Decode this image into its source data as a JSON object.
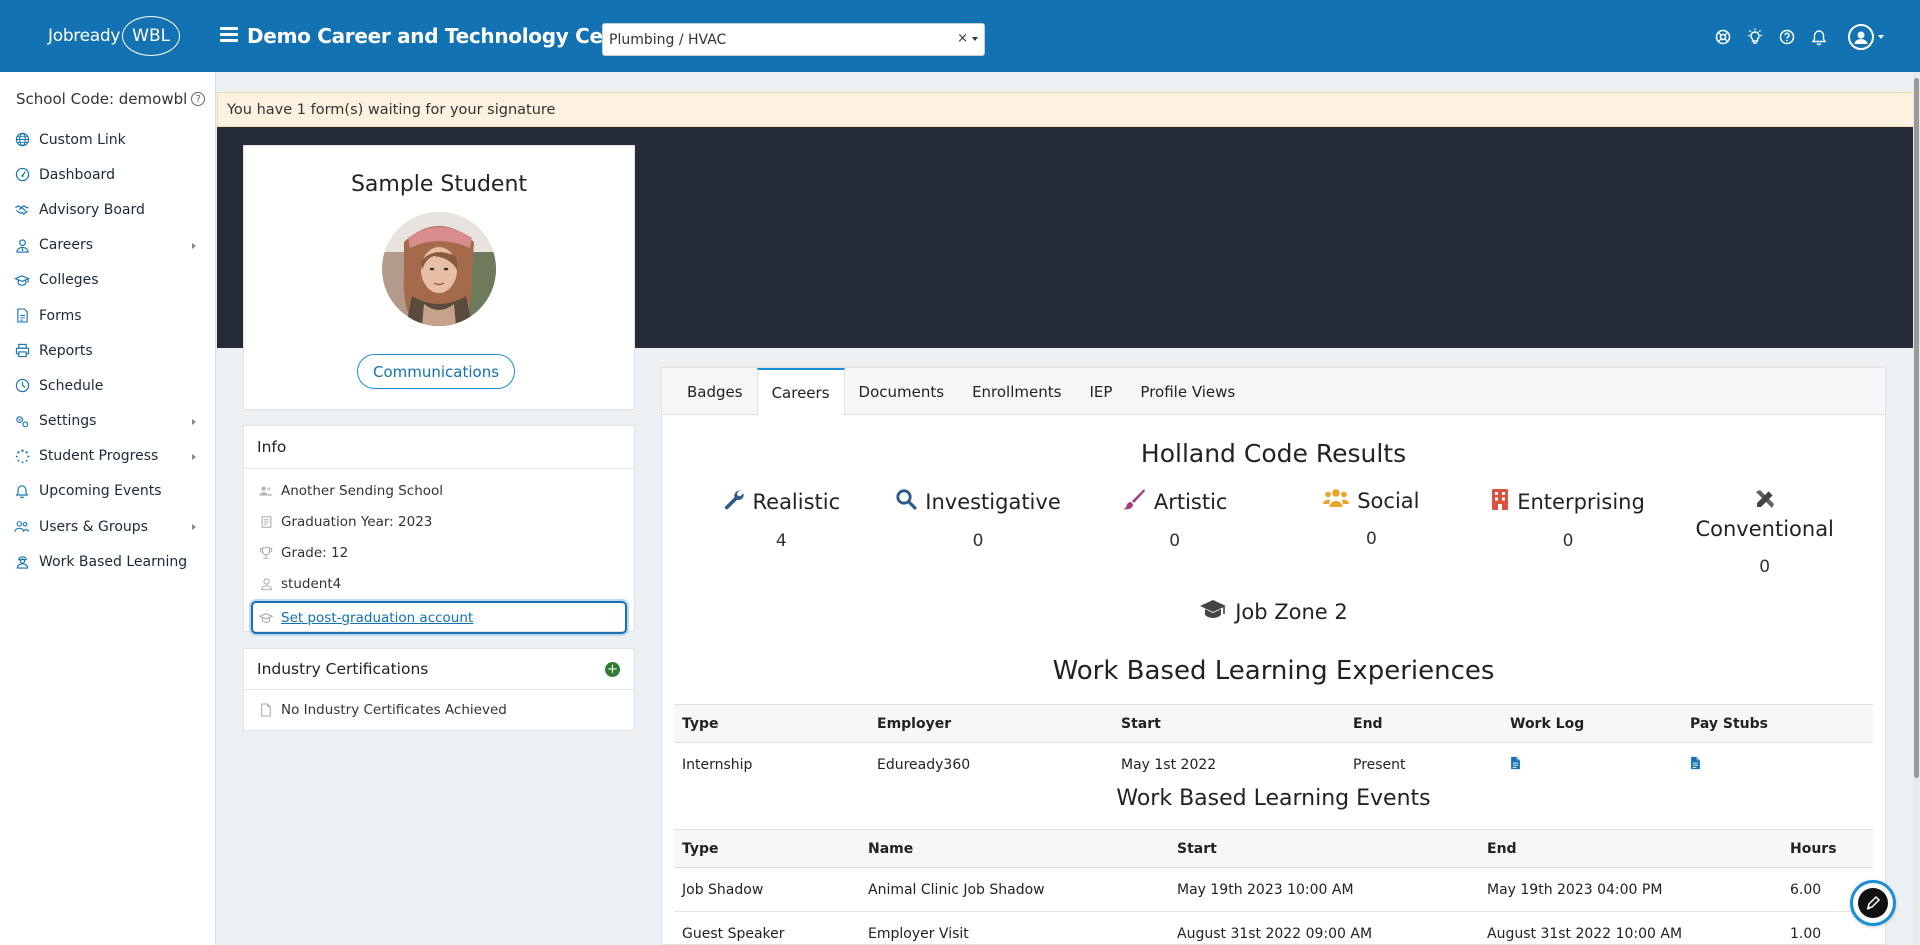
{
  "header": {
    "logo_text": "Jobready",
    "logo_badge": "WBL",
    "org_title": "Demo Career and Technology Center",
    "program_select": {
      "value": "Plumbing / HVAC",
      "clear": "×"
    },
    "icons": [
      "support-icon",
      "lightbulb-icon",
      "help-icon",
      "bell-icon",
      "user-avatar-icon"
    ],
    "brand_color": "#1272b2"
  },
  "sidebar": {
    "school_code": "School Code: demowbl",
    "help": "?",
    "items": [
      {
        "label": "Custom Link",
        "icon": "globe-icon",
        "has_submenu": false
      },
      {
        "label": "Dashboard",
        "icon": "gauge-icon",
        "has_submenu": false
      },
      {
        "label": "Advisory Board",
        "icon": "handshake-icon",
        "has_submenu": false
      },
      {
        "label": "Careers",
        "icon": "user-tie-icon",
        "has_submenu": true
      },
      {
        "label": "Colleges",
        "icon": "graduation-cap-icon",
        "has_submenu": false
      },
      {
        "label": "Forms",
        "icon": "document-icon",
        "has_submenu": false
      },
      {
        "label": "Reports",
        "icon": "printer-icon",
        "has_submenu": false
      },
      {
        "label": "Schedule",
        "icon": "clock-icon",
        "has_submenu": false
      },
      {
        "label": "Settings",
        "icon": "gears-icon",
        "has_submenu": true
      },
      {
        "label": "Student Progress",
        "icon": "spinner-icon",
        "has_submenu": true
      },
      {
        "label": "Upcoming Events",
        "icon": "bell-icon",
        "has_submenu": false
      },
      {
        "label": "Users & Groups",
        "icon": "users-icon",
        "has_submenu": true
      },
      {
        "label": "Work Based Learning",
        "icon": "worker-icon",
        "has_submenu": false
      }
    ]
  },
  "alert": {
    "text": "You have 1 form(s) waiting for your signature"
  },
  "profile": {
    "name": "Sample Student",
    "communications_label": "Communications"
  },
  "info": {
    "title": "Info",
    "rows": [
      {
        "icon": "users-icon",
        "text": "Another Sending School"
      },
      {
        "icon": "calendar-icon",
        "text": "Graduation Year: 2023"
      },
      {
        "icon": "trophy-icon",
        "text": "Grade: 12"
      },
      {
        "icon": "user-icon",
        "text": "student4"
      }
    ],
    "post_grad_link": "Set post-graduation account"
  },
  "certifications": {
    "title": "Industry Certifications",
    "empty_text": "No Industry Certificates Achieved"
  },
  "tabs": [
    "Badges",
    "Careers",
    "Documents",
    "Enrollments",
    "IEP",
    "Profile Views"
  ],
  "active_tab": "Careers",
  "holland": {
    "title": "Holland Code Results",
    "codes": [
      {
        "name": "Realistic",
        "value": "4",
        "icon": "wrench-icon",
        "color": "#2c5a8c"
      },
      {
        "name": "Investigative",
        "value": "0",
        "icon": "magnifier-icon",
        "color": "#2c5a8c"
      },
      {
        "name": "Artistic",
        "value": "0",
        "icon": "paintbrush-icon",
        "color": "#a83e79"
      },
      {
        "name": "Social",
        "value": "0",
        "icon": "people-icon",
        "color": "#e8a52c"
      },
      {
        "name": "Enterprising",
        "value": "0",
        "icon": "building-icon",
        "color": "#d9533f"
      },
      {
        "name": "Conventional",
        "value": "0",
        "icon": "ruler-pencil-icon",
        "color": "#444444"
      }
    ],
    "job_zone": "Job Zone 2"
  },
  "wbl_experiences": {
    "title": "Work Based Learning Experiences",
    "columns": [
      "Type",
      "Employer",
      "Start",
      "End",
      "Work Log",
      "Pay Stubs"
    ],
    "rows": [
      {
        "type": "Internship",
        "employer": "Eduready360",
        "start": "May 1st 2022",
        "end": "Present"
      }
    ]
  },
  "wbl_events": {
    "title": "Work Based Learning Events",
    "columns": [
      "Type",
      "Name",
      "Start",
      "End",
      "Hours"
    ],
    "rows": [
      {
        "type": "Job Shadow",
        "name": "Animal Clinic Job Shadow",
        "start": "May 19th 2023 10:00 AM",
        "end": "May 19th 2023 04:00 PM",
        "hours": "6.00"
      },
      {
        "type": "Guest Speaker",
        "name": "Employer Visit",
        "start": "August 31st 2022 09:00 AM",
        "end": "August 31st 2022 10:00 AM",
        "hours": "1.00"
      }
    ]
  }
}
